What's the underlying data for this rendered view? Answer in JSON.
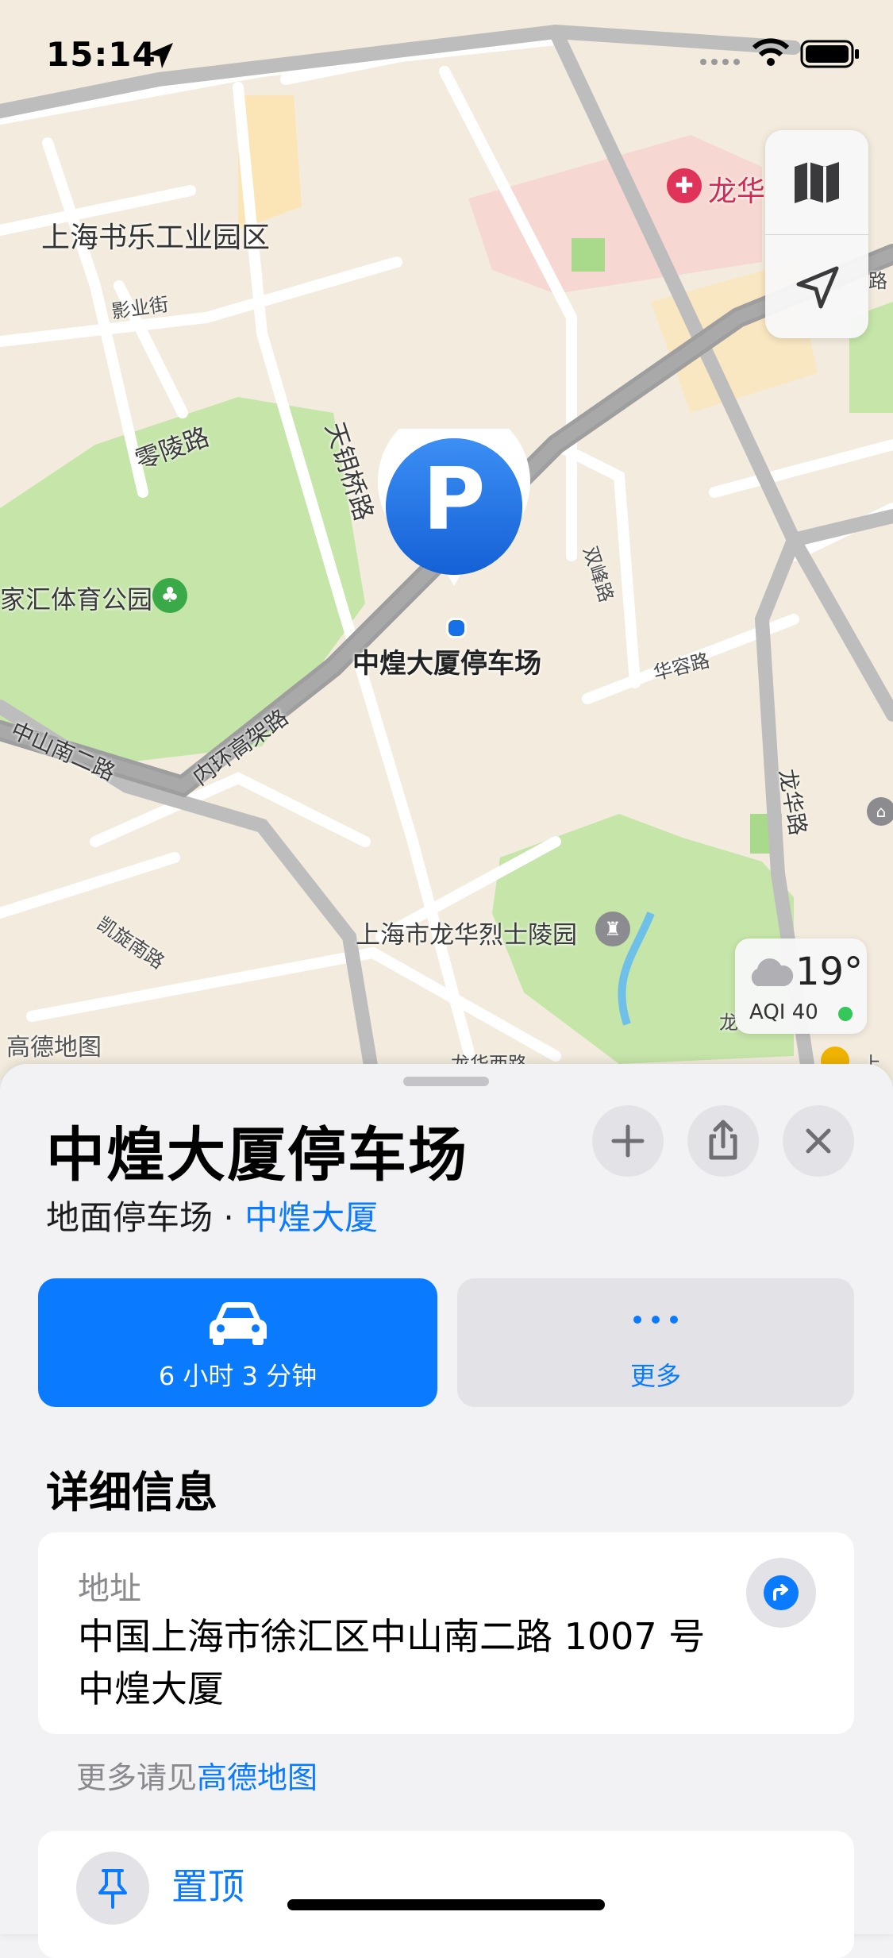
{
  "status_bar": {
    "time": "15:14"
  },
  "map": {
    "labels": {
      "industrial_park": "上海书乐工业园区",
      "longhua_top": "龙华",
      "yingye_street": "影业街",
      "lingling_road": "零陵路",
      "tianyaoqiao_road": "天钥桥路",
      "shuangfeng_road": "双峰路",
      "xujiahui_park": "家汇体育公园",
      "parking_name": "中煌大厦停车场",
      "huarong_road": "华容路",
      "zhongshan_s2_road": "中山南二路",
      "inner_ring": "内环高架路",
      "longhua_road": "龙华路",
      "kaixuan_s_road": "凯旋南路",
      "martyrs_cemetery": "上海市龙华烈士陵园",
      "gaode_attrib": "高德地图",
      "longhua_west_road": "龙华西路",
      "right_edge": "路",
      "right_edge_bottom": "上",
      "right_edge_mid": "龙"
    },
    "pin_letter": "P",
    "weather": {
      "temp": "19°",
      "aqi": "AQI 40",
      "aqi_color": "#34c759"
    }
  },
  "sheet": {
    "title": "中煌大厦停车场",
    "category": "地面停车场",
    "separator": " · ",
    "parent_place": "中煌大厦",
    "drive_label": "6 小时 3 分钟",
    "more_label": "更多",
    "details_heading": "详细信息",
    "address_label": "地址",
    "address_value": "中国上海市徐汇区中山南二路 1007 号中煌大厦",
    "more_info_prefix": "更多请见",
    "more_info_link": "高德地图",
    "pin_label": "置顶"
  },
  "colors": {
    "accent": "#0a7aff",
    "park": "#c5e5a9",
    "road": "#ffffff",
    "highway": "#9e9e9e"
  }
}
